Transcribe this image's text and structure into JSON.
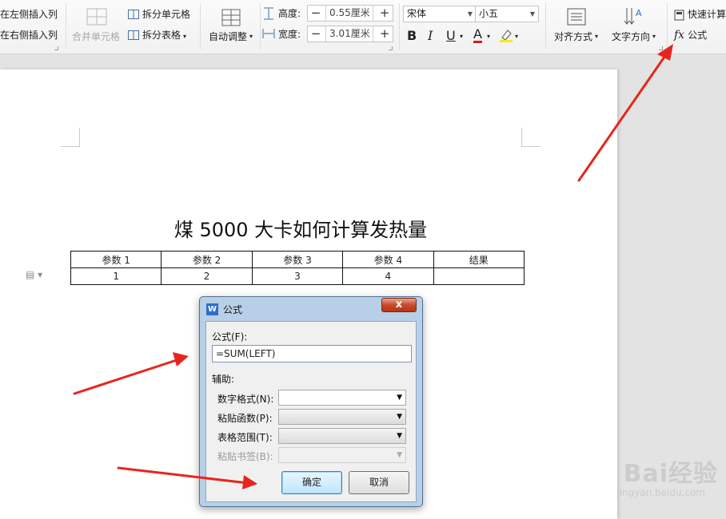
{
  "ribbon": {
    "insert_col_left": "在左侧插入列",
    "insert_col_right": "在右侧插入列",
    "merge_cells": "合并单元格",
    "split_cells": "拆分单元格",
    "split_table": "拆分表格",
    "auto_fit": "自动调整",
    "height_label": "高度:",
    "height_value": "0.55厘米",
    "width_label": "宽度:",
    "width_value": "3.01厘米",
    "font_name": "宋体",
    "font_size": "小五",
    "bold": "B",
    "italic": "I",
    "underline": "U",
    "font_color": "A",
    "align": "对齐方式",
    "text_direction": "文字方向",
    "quick_calc": "快速计算",
    "formula": "公式",
    "fx": "fx"
  },
  "document": {
    "title": "煤 5000 大卡如何计算发热量",
    "table": {
      "headers": [
        "参数 1",
        "参数 2",
        "参数 3",
        "参数 4",
        "结果"
      ],
      "rows": [
        [
          "1",
          "2",
          "3",
          "4",
          ""
        ]
      ]
    }
  },
  "dialog": {
    "title": "公式",
    "app_icon": "W",
    "close": "x",
    "formula_label": "公式(F):",
    "formula_value": "=SUM(LEFT)",
    "assist_label": "辅助:",
    "number_format_label": "数字格式(N):",
    "paste_function_label": "粘贴函数(P):",
    "table_range_label": "表格范围(T):",
    "paste_bookmark_label": "粘贴书签(B):",
    "ok": "确定",
    "cancel": "取消"
  },
  "watermark": {
    "brand": "Bai经验",
    "url": "jingyan.baidu.com"
  },
  "colors": {
    "arrow": "#e8251d",
    "accent": "#2e6fc7"
  }
}
